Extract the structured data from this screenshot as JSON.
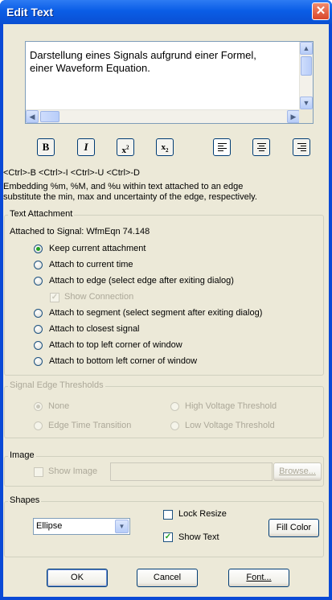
{
  "window": {
    "title": "Edit Text",
    "close": "✕"
  },
  "editor": {
    "text_line1": "Darstellung eines Signals aufgrund einer Formel,",
    "text_line2": "einer Waveform Equation."
  },
  "format_toolbar": {
    "bold": "B",
    "italic": "I",
    "superscript": "x",
    "subscript": "x"
  },
  "hints": {
    "shortcuts": "<Ctrl>-B <Ctrl>-I <Ctrl>-U <Ctrl>-D",
    "embedding_line1": "Embedding %m, %M, and %u  within text attached to an edge",
    "embedding_line2": "substitute the min, max and uncertainty of the edge, respectively."
  },
  "text_attachment": {
    "label": "Text Attachment",
    "attached_to": "Attached to Signal: WfmEqn 74.148",
    "options": [
      "Keep current attachment",
      "Attach to current time",
      "Attach to edge (select edge after exiting dialog)",
      "Attach to segment (select segment after exiting dialog)",
      "Attach to closest signal",
      "Attach to top left corner of window",
      "Attach to bottom left corner of window"
    ],
    "selected_index": 0,
    "show_connection": "Show Connection"
  },
  "thresholds": {
    "label": "Signal Edge Thresholds",
    "none": "None",
    "high": "High Voltage Threshold",
    "edge": "Edge Time Transition",
    "low": "Low Voltage Threshold"
  },
  "image": {
    "label": "Image",
    "show_image": "Show Image",
    "browse": "Browse..."
  },
  "shapes": {
    "label": "Shapes",
    "selected": "Ellipse",
    "lock_resize": "Lock Resize",
    "show_text": "Show Text",
    "fill_color": "Fill Color"
  },
  "buttons": {
    "ok": "OK",
    "cancel": "Cancel",
    "font": "Font..."
  },
  "colors": {
    "titlebar": "#0a5de6",
    "face": "#ece9d8",
    "close": "#d9462a"
  }
}
